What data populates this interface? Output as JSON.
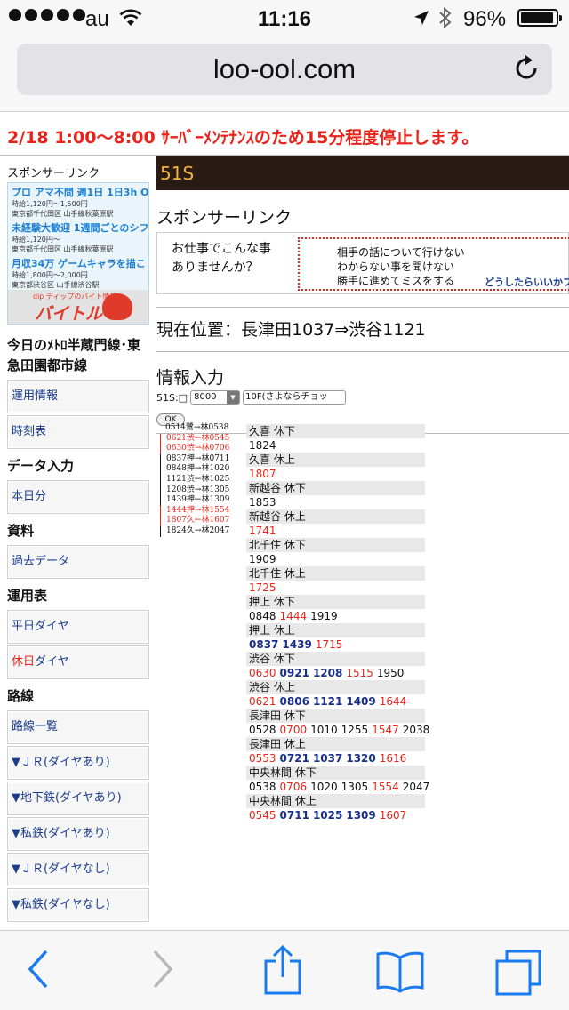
{
  "status": {
    "carrier": "au",
    "time": "11:16",
    "battery_pct": "96%",
    "battery_level": 0.96
  },
  "browser": {
    "url": "loo-ool.com"
  },
  "notice": "2/18 1:00〜8:00 ｻｰﾊﾞｰﾒﾝﾃﾅﾝｽのため15分程度停止します。",
  "left": {
    "sponsor_label": "スポンサーリンク",
    "ad": {
      "items": [
        {
          "title": "プロ アマ不問 週1日 1日3h OK",
          "line1": "時給1,120円〜1,500円",
          "line2": "東京都千代田区 山手線秋葉原駅"
        },
        {
          "title": "未経験大歓迎 1週間ごとのシフ",
          "line1": "時給1,120円〜",
          "line2": "東京都千代田区 山手線秋葉原駅"
        },
        {
          "title": "月収34万 ゲームキャラを描こ",
          "line1": "時給1,800円〜2,000円",
          "line2": "東京都渋谷区 山手線渋谷駅"
        }
      ],
      "brand_small": "dip ディップのバイト情報",
      "brand": "バイトル"
    },
    "sections": [
      {
        "heading": "今日のﾒﾄﾛ半蔵門線･東急田園都市線",
        "links": [
          "運用情報",
          "時刻表"
        ]
      },
      {
        "heading": "データ入力",
        "links": [
          "本日分"
        ]
      },
      {
        "heading": "資料",
        "links": [
          "過去データ"
        ]
      },
      {
        "heading": "運用表",
        "links": [
          "平日ダイヤ"
        ]
      },
      {
        "heading": "路線",
        "links": [
          "路線一覧",
          "▼ＪＲ(ダイヤあり)",
          "▼地下鉄(ダイヤあり)",
          "▼私鉄(ダイヤあり)",
          "▼ＪＲ(ダイヤなし)",
          "▼私鉄(ダイヤなし)"
        ]
      }
    ],
    "holiday_link": {
      "red": "休日",
      "rest": "ダイヤ"
    }
  },
  "main": {
    "title": "51S",
    "sponsor_label": "スポンサーリンク",
    "banner": {
      "hand_line1": "お仕事でこんな事",
      "hand_line2": "ありませんか？",
      "lines": [
        "相手の話について行けない",
        "わからない事を聞けない",
        "勝手に進めてミスをする"
      ],
      "cta": "どうしたらいいかフ"
    },
    "current_position": "現在位置：長津田1037⇒渋谷1121",
    "info_heading": "情報入力",
    "form": {
      "label": "51S:□",
      "select_value": "8000",
      "text_value": "10F(さよならチョッ",
      "ok_label": "OK"
    }
  },
  "runs": [
    {
      "text": "0514鷺→林0538",
      "red": false
    },
    {
      "text": "0621渋←林0545",
      "red": true
    },
    {
      "text": "0630渋→林0706",
      "red": true
    },
    {
      "text": "0837押→林0711",
      "red": false
    },
    {
      "text": "0848押→林1020",
      "red": false
    },
    {
      "text": "1121渋←林1025",
      "red": false
    },
    {
      "text": "1208渋→林1305",
      "red": false
    },
    {
      "text": "1439押←林1309",
      "red": false
    },
    {
      "text": "1444押→林1554",
      "red": true
    },
    {
      "text": "1807久←林1607",
      "red": true
    },
    {
      "text": "1824久→林2047",
      "red": false
    }
  ],
  "timetable": [
    {
      "header": "久喜 休下",
      "times": [
        {
          "t": "1824",
          "c": "black"
        }
      ]
    },
    {
      "header": "久喜 休上",
      "times": [
        {
          "t": "1807",
          "c": "red"
        }
      ]
    },
    {
      "header": "新越谷 休下",
      "times": [
        {
          "t": "1853",
          "c": "black"
        }
      ]
    },
    {
      "header": "新越谷 休上",
      "times": [
        {
          "t": "1741",
          "c": "red"
        }
      ]
    },
    {
      "header": "北千住 休下",
      "times": [
        {
          "t": "1909",
          "c": "black"
        }
      ]
    },
    {
      "header": "北千住 休上",
      "times": [
        {
          "t": "1725",
          "c": "red"
        }
      ]
    },
    {
      "header": "押上 休下",
      "times": [
        {
          "t": "0848",
          "c": "black"
        },
        {
          "t": "1444",
          "c": "red"
        },
        {
          "t": "1919",
          "c": "black"
        }
      ]
    },
    {
      "header": "押上 休上",
      "times": [
        {
          "t": "0837",
          "c": "blue"
        },
        {
          "t": "1439",
          "c": "blue"
        },
        {
          "t": "1715",
          "c": "red"
        }
      ]
    },
    {
      "header": "渋谷 休下",
      "times": [
        {
          "t": "0630",
          "c": "red"
        },
        {
          "t": "0921",
          "c": "blue"
        },
        {
          "t": "1208",
          "c": "blue"
        },
        {
          "t": "1515",
          "c": "red"
        },
        {
          "t": "1950",
          "c": "black"
        }
      ]
    },
    {
      "header": "渋谷 休上",
      "times": [
        {
          "t": "0621",
          "c": "red"
        },
        {
          "t": "0806",
          "c": "blue"
        },
        {
          "t": "1121",
          "c": "blue"
        },
        {
          "t": "1409",
          "c": "blue"
        },
        {
          "t": "1644",
          "c": "red"
        }
      ]
    },
    {
      "header": "長津田 休下",
      "times": [
        {
          "t": "0528",
          "c": "black"
        },
        {
          "t": "0700",
          "c": "red"
        },
        {
          "t": "1010",
          "c": "black"
        },
        {
          "t": "1255",
          "c": "black"
        },
        {
          "t": "1547",
          "c": "red"
        },
        {
          "t": "2038",
          "c": "black"
        }
      ]
    },
    {
      "header": "長津田 休上",
      "times": [
        {
          "t": "0553",
          "c": "red"
        },
        {
          "t": "0721",
          "c": "blue"
        },
        {
          "t": "1037",
          "c": "blue"
        },
        {
          "t": "1320",
          "c": "blue"
        },
        {
          "t": "1616",
          "c": "red"
        }
      ]
    },
    {
      "header": "中央林間 休下",
      "times": [
        {
          "t": "0538",
          "c": "black"
        },
        {
          "t": "0706",
          "c": "red"
        },
        {
          "t": "1020",
          "c": "black"
        },
        {
          "t": "1305",
          "c": "black"
        },
        {
          "t": "1554",
          "c": "red"
        },
        {
          "t": "2047",
          "c": "black"
        }
      ]
    },
    {
      "header": "中央林間 休上",
      "times": [
        {
          "t": "0545",
          "c": "red"
        },
        {
          "t": "0711",
          "c": "blue"
        },
        {
          "t": "1025",
          "c": "blue"
        },
        {
          "t": "1309",
          "c": "blue"
        },
        {
          "t": "1607",
          "c": "red"
        }
      ]
    }
  ],
  "colors": {
    "red": "#e8231a",
    "blue": "#1a2f8c",
    "title_bg": "#2a1a14",
    "title_fg": "#f1b43a",
    "ios_blue": "#1a7bf0"
  },
  "icons": [
    "wifi-icon",
    "location-icon",
    "bluetooth-icon",
    "battery-icon",
    "reload-icon",
    "back-icon",
    "forward-icon",
    "share-icon",
    "bookmarks-icon",
    "tabs-icon"
  ]
}
